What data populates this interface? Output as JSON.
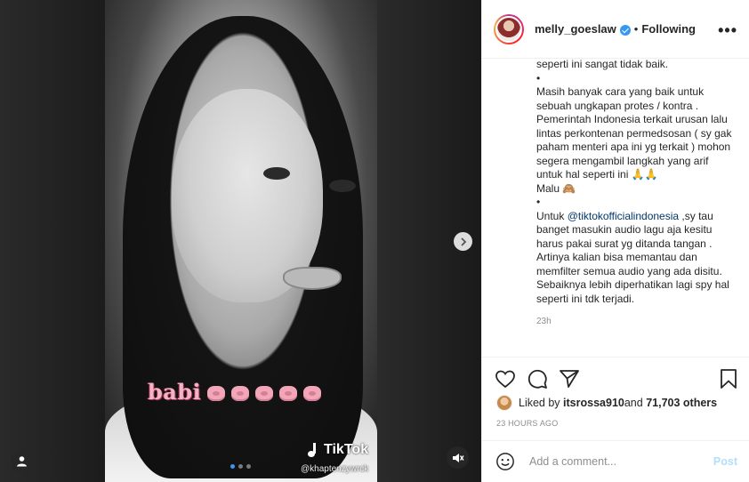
{
  "post": {
    "username": "melly_goeslaw",
    "separator": "•",
    "follow_status": "Following",
    "more_label": "•••"
  },
  "media": {
    "overlay_caption": "babi",
    "overlay_emoji_count": 5,
    "watermark_brand": "TikTok",
    "watermark_handle": "@khaptenzywrck",
    "carousel_slides": 3,
    "carousel_active_index": 0
  },
  "caption": {
    "line_cut": "seperti ini sangat tidak baik.",
    "bullet_1": "•",
    "paragraph_1": "Masih banyak cara yang baik untuk sebuah ungkapan protes / kontra . Pemerintah Indonesia terkait urusan lalu lintas perkontenan permedsosan ( sy gak paham menteri apa ini yg terkait ) mohon segera mengambil langkah yang arif untuk hal seperti ini 🙏🙏",
    "paragraph_1_end": "Malu 🙈",
    "bullet_2": "•",
    "paragraph_2_prefix": "Untuk ",
    "mention": "@tiktokofficialindonesia",
    "paragraph_2_suffix": " ,sy tau banget masukin audio lagu aja kesitu harus pakai surat yg ditanda tangan . Artinya kalian bisa memantau dan memfilter semua audio yang ada disitu. Sebaiknya lebih diperhatikan lagi spy hal seperti ini tdk terjadi.",
    "age": "23h"
  },
  "likes": {
    "prefix": "Liked by ",
    "user": "itsrossa910",
    "middle": " and ",
    "count": "71,703 others"
  },
  "posted_time": "23 HOURS AGO",
  "comment_input": {
    "placeholder": "Add a comment...",
    "post_label": "Post"
  },
  "colors": {
    "link": "#00376b",
    "verified": "#3897f0",
    "post_disabled": "#b2dffc",
    "muted": "#8e8e8e"
  }
}
